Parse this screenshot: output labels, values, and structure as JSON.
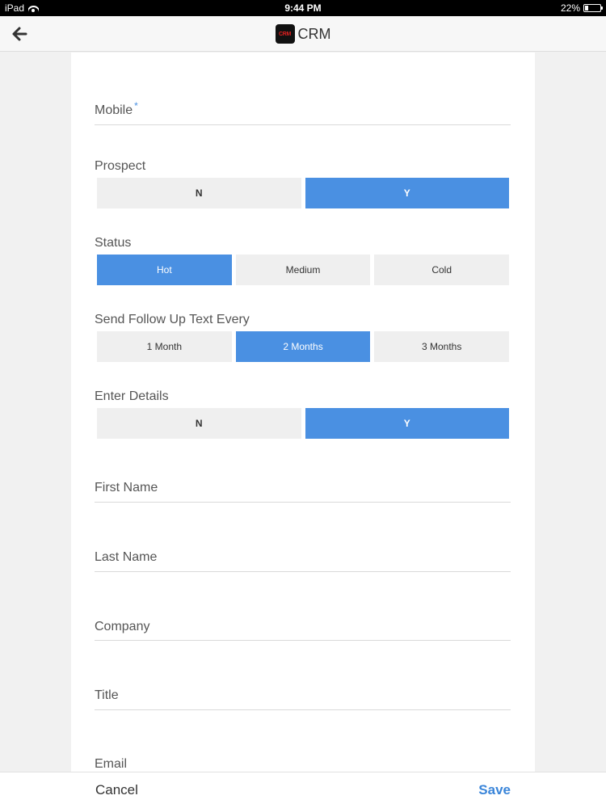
{
  "status_bar": {
    "device": "iPad",
    "time": "9:44 PM",
    "battery": "22%",
    "battery_level": 0.22
  },
  "nav": {
    "title": "CRM",
    "logo_text": "CRM"
  },
  "form": {
    "mobile_label": "Mobile",
    "required_mark": "*",
    "prospect": {
      "label": "Prospect",
      "options": [
        "N",
        "Y"
      ],
      "selected": "Y"
    },
    "status": {
      "label": "Status",
      "options": [
        "Hot",
        "Medium",
        "Cold"
      ],
      "selected": "Hot"
    },
    "follow_up": {
      "label": "Send Follow Up Text Every",
      "options": [
        "1 Month",
        "2 Months",
        "3 Months"
      ],
      "selected": "2 Months"
    },
    "enter_details": {
      "label": "Enter Details",
      "options": [
        "N",
        "Y"
      ],
      "selected": "Y"
    },
    "first_name_label": "First Name",
    "last_name_label": "Last Name",
    "company_label": "Company",
    "title_label": "Title",
    "email_label": "Email"
  },
  "bottom": {
    "cancel_label": "Cancel",
    "save_label": "Save"
  },
  "colors": {
    "accent": "#4a90e2",
    "save": "#3a85d9"
  }
}
